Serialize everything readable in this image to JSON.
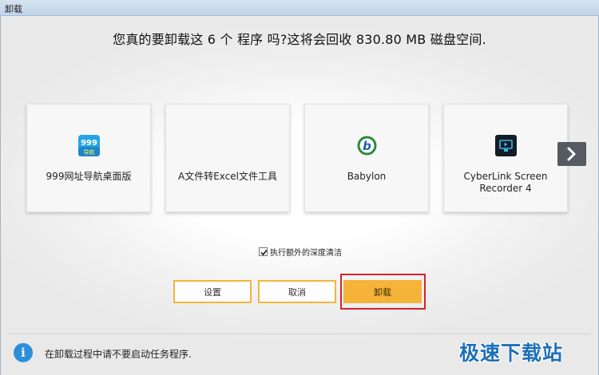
{
  "window": {
    "title": "卸载"
  },
  "headline": "您真的要卸载这 6 个 程序 吗?这将会回收 830.80 MB 磁盘空间.",
  "programs": [
    {
      "name": "999网址导航桌面版",
      "icon": "999-navigation-icon",
      "icon_text_top": "999",
      "icon_text_bottom": "导航"
    },
    {
      "name": "A文件转Excel文件工具",
      "icon": ""
    },
    {
      "name": "Babylon",
      "icon": "babylon-icon",
      "icon_letter": "b"
    },
    {
      "name": "CyberLink Screen Recorder 4",
      "icon": "cyberlink-screen-recorder-icon"
    }
  ],
  "next_icon": "chevron-right-icon",
  "options": {
    "deep_clean_label": "执行额外的深度清洁",
    "deep_clean_checked": true
  },
  "buttons": {
    "settings": "设置",
    "cancel": "取消",
    "uninstall": "卸载"
  },
  "footer": {
    "info_icon_glyph": "i",
    "info_text": "在卸载过程中请不要启动任务程序."
  },
  "watermark": "极速下载站",
  "colors": {
    "accent": "#f5b33a",
    "highlight": "#d6232b",
    "info": "#2e8fd8",
    "arrow_bg": "#555b60"
  }
}
